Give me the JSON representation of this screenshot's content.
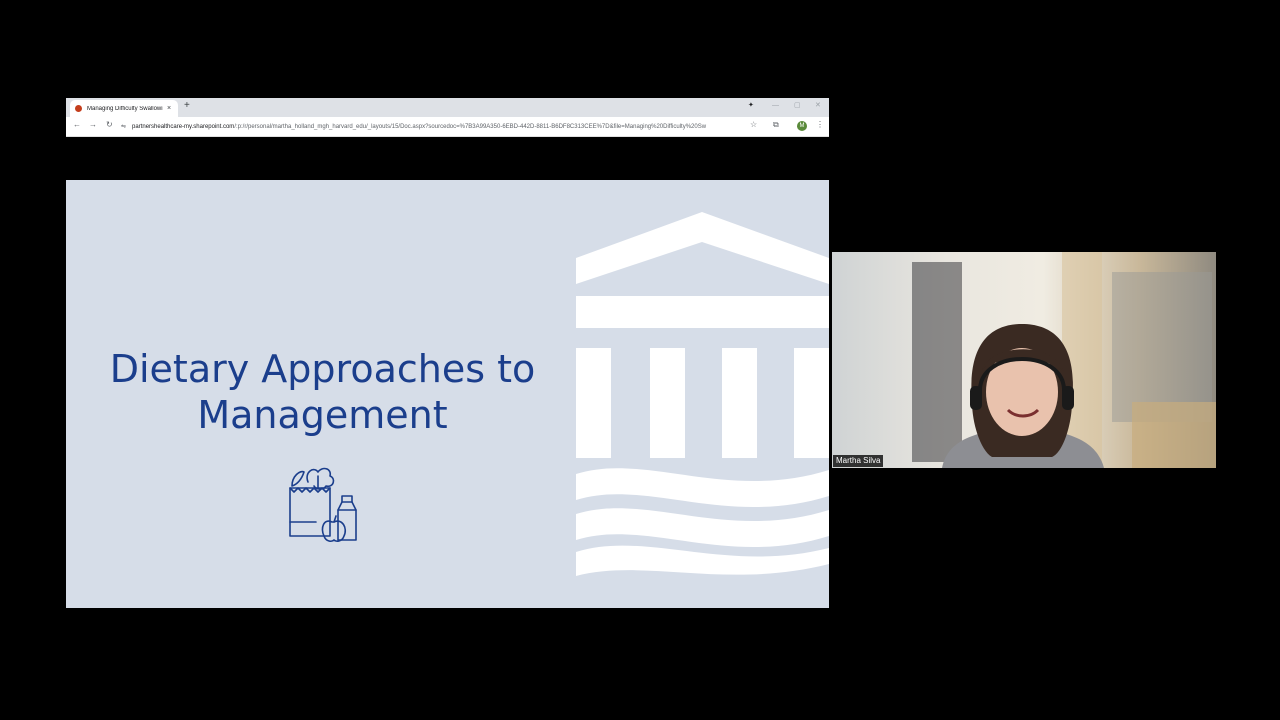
{
  "browser": {
    "tab_title": "Managing Difficulty Swallowin",
    "tab_close": "×",
    "new_tab": "+",
    "url_host": "partnershealthcare-my.sharepoint.com",
    "url_path": "/:p:/r/personal/martha_holland_mgh_harvard_edu/_layouts/15/Doc.aspx?sourcedoc=%7B3A99A350-6EBD-442D-8811-B6DF8C313CEE%7D&file=Managing%20Difficulty%20Sw",
    "icons": [
      "back-icon",
      "forward-icon",
      "reload-icon",
      "site-info-icon",
      "star-icon",
      "extensions-icon",
      "menu-icon"
    ],
    "profile_initial": "M"
  },
  "slide": {
    "title_line1": "Dietary Approaches to",
    "title_line2": "Management",
    "title_color": "#1b3e8c",
    "background_color": "#d6dde8"
  },
  "participant": {
    "name": "Martha Silva"
  }
}
